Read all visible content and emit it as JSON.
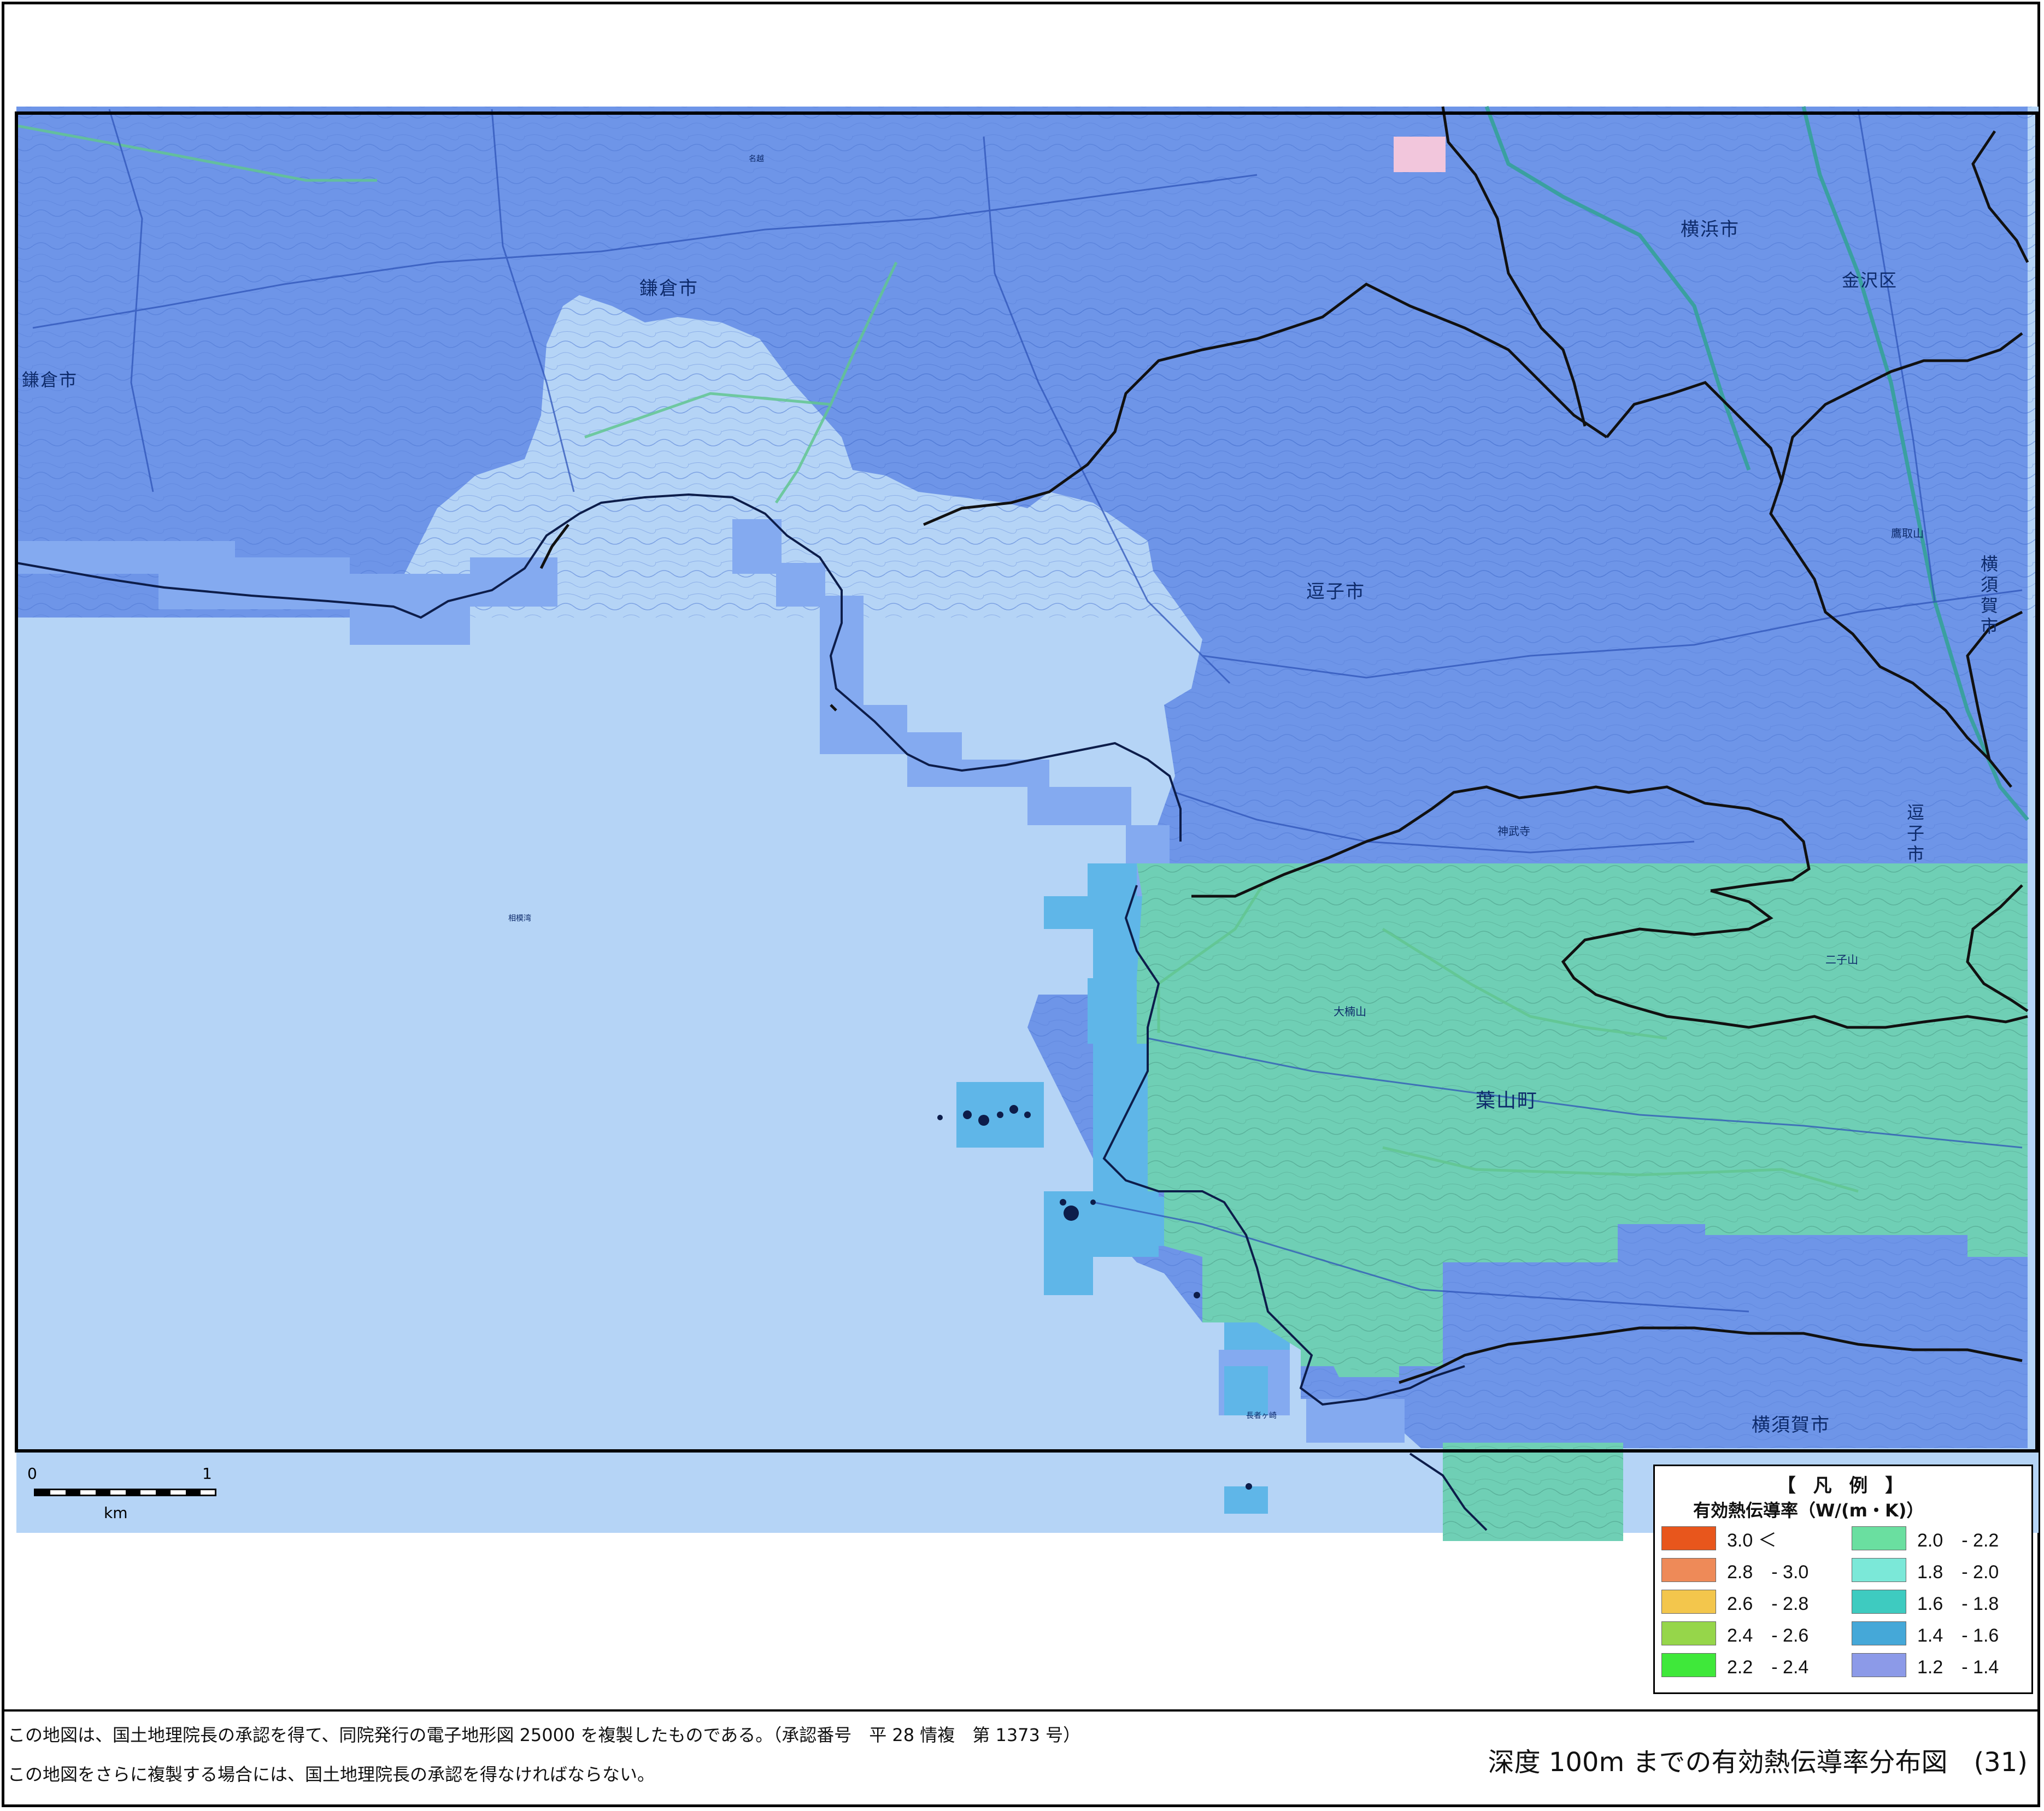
{
  "map": {
    "places": {
      "kamakura_north": "鎌倉市",
      "kamakura_west": "鎌倉市",
      "yokohama": "横浜市",
      "kanazawa": "金沢区",
      "zushi": "逗子市",
      "zushi_east": "逗子市",
      "yokosuka_east": "横須賀市",
      "hayama": "葉山町",
      "yokosuka_south": "横須賀市"
    },
    "minor": {
      "sagami_bay": "相模湾",
      "futago_yama": "二子山",
      "ogusu_yama": "大楠山",
      "takatori_yama": "鷹取山",
      "jinmu_ji": "神武寺",
      "chojagasaki": "長者ヶ崎",
      "nagoe": "名越"
    },
    "colors": {
      "sea": "#b5d4f6",
      "land_blue": "#6e95e8",
      "coast_cells": "#84aaf0",
      "cyan_cells": "#5fb6e8",
      "green_zone": "#6fcfb5",
      "hillside_pink": "#f2c6dc",
      "boundary": "#111111",
      "rail": "#3aa0a0",
      "road": "#2f54b8"
    }
  },
  "scale": {
    "tick_start": "0",
    "tick_end": "1",
    "unit": "km"
  },
  "legend": {
    "title": "【 凡 例 】",
    "subtitle": "有効熱伝導率（W/(m・K)）",
    "items": [
      {
        "range": "3.0 ＜",
        "color": "#e8561c"
      },
      {
        "range": "2.8　- 3.0",
        "color": "#ee8a58"
      },
      {
        "range": "2.6　- 2.8",
        "color": "#f3c64c"
      },
      {
        "range": "2.4　- 2.6",
        "color": "#96d64a"
      },
      {
        "range": "2.2　- 2.4",
        "color": "#3fe83a"
      },
      {
        "range": "2.0　- 2.2",
        "color": "#6adfa0"
      },
      {
        "range": "1.8　- 2.0",
        "color": "#7be8d8"
      },
      {
        "range": "1.6　- 1.8",
        "color": "#3ecbc0"
      },
      {
        "range": "1.4　- 1.6",
        "color": "#45a8d8"
      },
      {
        "range": "1.2　- 1.4",
        "color": "#8c9ae8"
      }
    ]
  },
  "footer": {
    "note1": "この地図は、国土地理院長の承認を得て、同院発行の電子地形図 25000 を複製したものである。（承認番号　平 28 情複　第 1373 号）",
    "note2": "この地図をさらに複製する場合には、国土地理院長の承認を得なければならない。",
    "title": "深度 100m までの有効熱伝導率分布図　(31)"
  }
}
